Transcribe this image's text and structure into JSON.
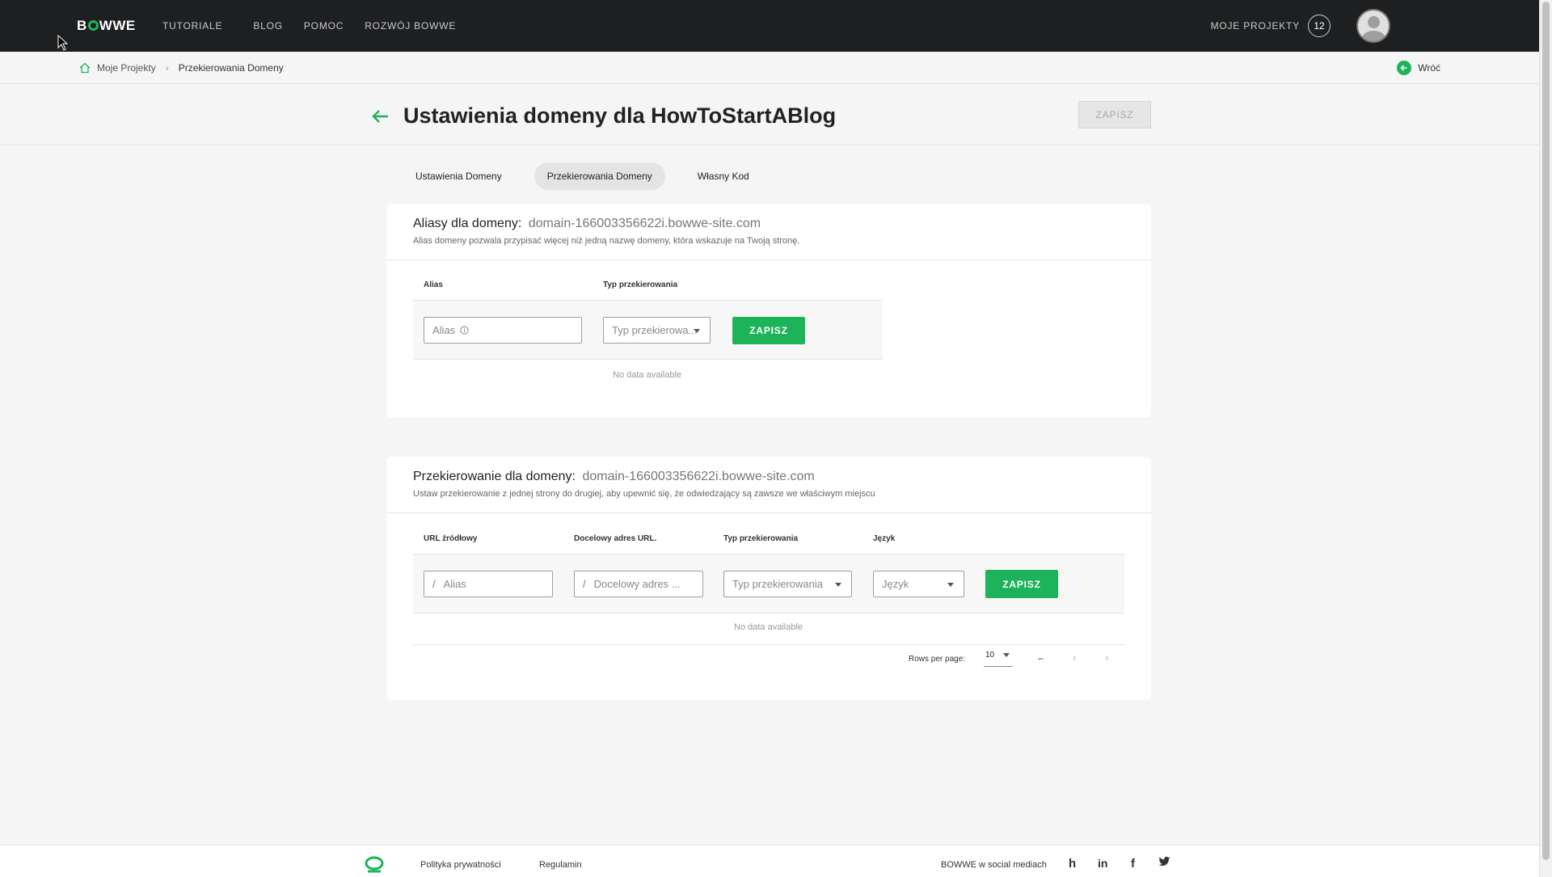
{
  "nav": {
    "logo": "BOWWE",
    "links": [
      "TUTORIALE",
      "BLOG",
      "POMOC",
      "ROZWÓJ BOWWE"
    ],
    "projects_label": "MOJE PROJEKTY",
    "projects_count": "12"
  },
  "breadcrumb": {
    "home": "Moje Projekty",
    "current": "Przekierowania Domeny",
    "back": "Wróć"
  },
  "header": {
    "title": "Ustawienia domeny dla HowToStartABlog",
    "save_label": "ZAPISZ"
  },
  "tabs": [
    {
      "label": "Ustawienia Domeny",
      "active": false
    },
    {
      "label": "Przekierowania Domeny",
      "active": true
    },
    {
      "label": "Własny Kod",
      "active": false
    }
  ],
  "aliases": {
    "title": "Aliasy dla domeny:",
    "domain": "domain-166003356622i.bowwe-site.com",
    "subtitle": "Alias domeny pozwala przypisać więcej niż jedną nazwę domeny, która wskazuje na Twoją stronę.",
    "col_alias": "Alias",
    "col_type": "Typ przekierowania",
    "alias_placeholder": "Alias",
    "type_placeholder": "Typ przekierowa...",
    "save_label": "ZAPISZ",
    "no_data": "No data available"
  },
  "redirects": {
    "title": "Przekierowanie dla domeny:",
    "domain": "domain-166003356622i.bowwe-site.com",
    "subtitle": "Ustaw przekierowanie z jednej strony do drugiej, aby upewnić się, że odwiedzający są zawsze we właściwym miejscu",
    "col_source": "URL źródłowy",
    "col_target": "Docelowy adres URL.",
    "col_type": "Typ przekierowania",
    "col_lang": "Język",
    "source_placeholder": "Alias",
    "target_placeholder": "Docelowy adres ...",
    "type_placeholder": "Typ przekierowania",
    "lang_placeholder": "Język",
    "save_label": "ZAPISZ",
    "no_data": "No data available",
    "rows_per_page_label": "Rows per page:",
    "rows_per_page_value": "10",
    "page_info": "–"
  },
  "footer": {
    "privacy": "Polityka prywatności",
    "terms": "Regulamin",
    "social_label": "BOWWE w social mediach"
  },
  "colors": {
    "brand_green": "#1db35a",
    "nav_bg": "#1e1f21"
  }
}
